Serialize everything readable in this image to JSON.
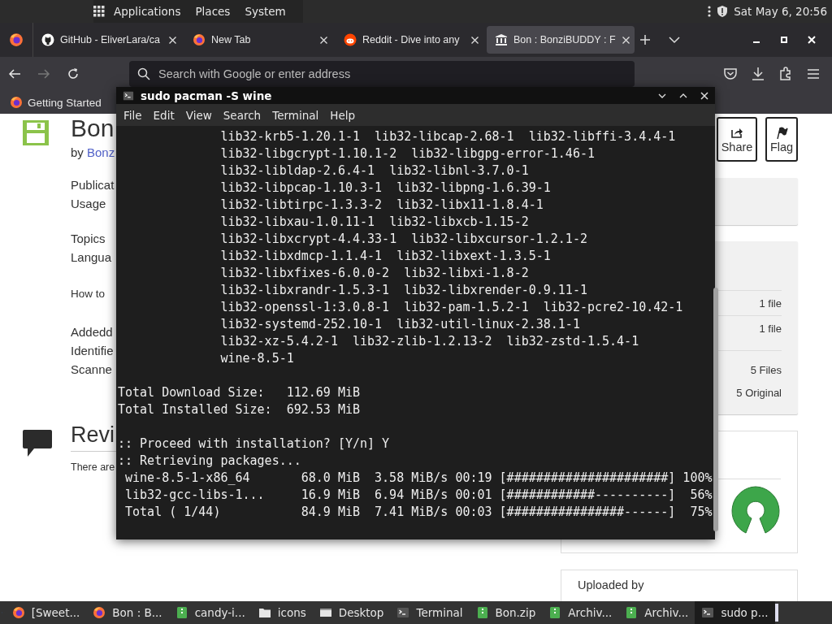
{
  "top_panel": {
    "menus": [
      "Applications",
      "Places",
      "System"
    ],
    "clock": "Sat May 6, 20:56"
  },
  "browser": {
    "tabs": [
      {
        "title": "GitHub - EliverLara/ca",
        "kind": "github",
        "selected": false
      },
      {
        "title": "New Tab",
        "kind": "firefox",
        "selected": false
      },
      {
        "title": "Reddit - Dive into any",
        "kind": "reddit",
        "selected": false
      },
      {
        "title": "Bon : BonziBUDDY : F",
        "kind": "archive",
        "selected": true
      }
    ],
    "forward_button": {
      "disabled": true
    },
    "address_bar": {
      "placeholder": "Search with Google or enter address"
    },
    "bookmarks": [
      "Getting Started"
    ]
  },
  "page": {
    "title": "Bon",
    "byline": "by",
    "author": "Bonz",
    "actions": [
      {
        "label": "Share",
        "kind": "share"
      },
      {
        "label": "Flag",
        "kind": "flag"
      }
    ],
    "detail_groups": [
      {
        "kind": "field",
        "lines": [
          "Publicat",
          "Usage"
        ]
      },
      {
        "kind": "field",
        "lines": [
          "Topics",
          "Langua"
        ]
      },
      {
        "kind": "note",
        "lines": [
          "How to"
        ]
      },
      {
        "kind": "field",
        "lines": [
          "Addedd",
          "Identifie",
          "Scanne"
        ]
      }
    ],
    "reviews_heading": "Revi",
    "reviews_text": "There are",
    "file_counts": [
      "1 file",
      "1 file"
    ],
    "file_totals": [
      "5 Files",
      "5 Original"
    ],
    "uploader_heading": "Uploaded by"
  },
  "terminal": {
    "title": "sudo pacman -S wine",
    "menu": [
      "File",
      "Edit",
      "View",
      "Search",
      "Terminal",
      "Help"
    ],
    "lines": [
      {
        "kind": "package",
        "text": "lib32-krb5-1.20.1-1  lib32-libcap-2.68-1  lib32-libffi-3.4.4-1"
      },
      {
        "kind": "package",
        "text": "lib32-libgcrypt-1.10.1-2  lib32-libgpg-error-1.46-1"
      },
      {
        "kind": "package",
        "text": "lib32-libldap-2.6.4-1  lib32-libnl-3.7.0-1"
      },
      {
        "kind": "package",
        "text": "lib32-libpcap-1.10.3-1  lib32-libpng-1.6.39-1"
      },
      {
        "kind": "package",
        "text": "lib32-libtirpc-1.3.3-2  lib32-libx11-1.8.4-1"
      },
      {
        "kind": "package",
        "text": "lib32-libxau-1.0.11-1  lib32-libxcb-1.15-2"
      },
      {
        "kind": "package",
        "text": "lib32-libxcrypt-4.4.33-1  lib32-libxcursor-1.2.1-2"
      },
      {
        "kind": "package",
        "text": "lib32-libxdmcp-1.1.4-1  lib32-libxext-1.3.5-1"
      },
      {
        "kind": "package",
        "text": "lib32-libxfixes-6.0.0-2  lib32-libxi-1.8-2"
      },
      {
        "kind": "package",
        "text": "lib32-libxrandr-1.5.3-1  lib32-libxrender-0.9.11-1"
      },
      {
        "kind": "package",
        "text": "lib32-openssl-1:3.0.8-1  lib32-pam-1.5.2-1  lib32-pcre2-10.42-1"
      },
      {
        "kind": "package",
        "text": "lib32-systemd-252.10-1  lib32-util-linux-2.38.1-1"
      },
      {
        "kind": "package",
        "text": "lib32-xz-5.4.2-1  lib32-zlib-1.2.13-2  lib32-zstd-1.5.4-1"
      },
      {
        "kind": "package",
        "text": "wine-8.5-1"
      },
      {
        "kind": "blank"
      },
      {
        "kind": "plain",
        "text": "Total Download Size:   112.69 MiB"
      },
      {
        "kind": "plain",
        "text": "Total Installed Size:  692.53 MiB"
      },
      {
        "kind": "blank"
      },
      {
        "kind": "plain",
        "text": ":: Proceed with installation? [Y/n] Y"
      },
      {
        "kind": "plain",
        "text": ":: Retrieving packages..."
      },
      {
        "kind": "progress",
        "text": "wine-8.5-1-x86_64       68.0 MiB  3.58 MiB/s 00:19 [######################] 100%"
      },
      {
        "kind": "progress",
        "text": "lib32-gcc-libs-1...     16.9 MiB  6.94 MiB/s 00:01 [############----------]  56%"
      },
      {
        "kind": "progress",
        "text": "Total ( 1/44)           84.9 MiB  7.41 MiB/s 00:03 [################------]  75%"
      }
    ]
  },
  "taskbar": {
    "items": [
      {
        "label": "[Sweet...",
        "kind": "firefox",
        "selected": false
      },
      {
        "label": "Bon : B...",
        "kind": "firefox",
        "selected": false
      },
      {
        "label": "candy-i...",
        "kind": "archive",
        "selected": false
      },
      {
        "label": "icons",
        "kind": "folder",
        "selected": false
      },
      {
        "label": "Desktop",
        "kind": "desktop",
        "selected": false
      },
      {
        "label": "Terminal",
        "kind": "terminal",
        "selected": false
      },
      {
        "label": "Bon.zip",
        "kind": "archive",
        "selected": false
      },
      {
        "label": "Archiv...",
        "kind": "archive",
        "selected": false
      },
      {
        "label": "Archiv...",
        "kind": "archive",
        "selected": false
      },
      {
        "label": "sudo p...",
        "kind": "terminal",
        "selected": true
      }
    ]
  }
}
